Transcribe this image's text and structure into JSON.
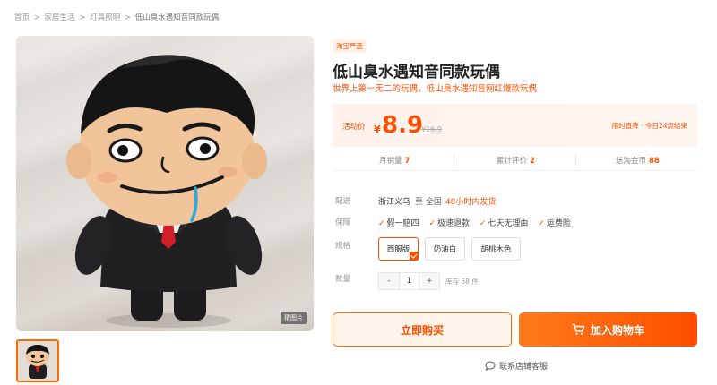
{
  "breadcrumb": {
    "items": [
      "首页",
      "家居生活",
      "灯具照明",
      "低山臭水遇知音同款玩偶"
    ],
    "separator": ">"
  },
  "media": {
    "badge": "猜图片",
    "main_image_icon": "plush-doll-photo",
    "thumbnail_icon": "plush-doll-thumbnail"
  },
  "product": {
    "tag": "淘宝严选",
    "title": "低山臭水遇知音同款玩偶",
    "subtitle": "世界上第一无二的玩偶，低山臭水遇知音网红爆款玩偶"
  },
  "price": {
    "label": "活动价",
    "currency": "¥",
    "value": "8.9",
    "original": "¥16.9",
    "promo": "限时直降 · 今日24点结束"
  },
  "stats": {
    "monthly_sales_label": "月销量",
    "monthly_sales": "7",
    "reviews_label": "累计评价",
    "reviews": "2",
    "coins_label": "送淘金币",
    "coins": "88"
  },
  "shipping": {
    "label": "配送",
    "from": "浙江义乌",
    "to": "至 全国",
    "time": "48小时内发货"
  },
  "guarantee": {
    "label": "保障",
    "check": "✓",
    "items": [
      "假一赔四",
      "极速退款",
      "七天无理由",
      "运费险"
    ]
  },
  "specs": {
    "label": "规格",
    "options": [
      "西服版",
      "奶油白",
      "胡桃木色"
    ],
    "selected_index": 0
  },
  "quantity": {
    "label": "数量",
    "minus": "-",
    "plus": "+",
    "value": "1",
    "stock": "库存 68 件"
  },
  "actions": {
    "buy_now": "立即购买",
    "add_to_cart": "加入购物车",
    "contact": "联系店铺客服"
  },
  "colors": {
    "accent": "#ff5000",
    "accent_gradient_start": "#ff7a1a",
    "buy_bg": "#fff3ea"
  }
}
